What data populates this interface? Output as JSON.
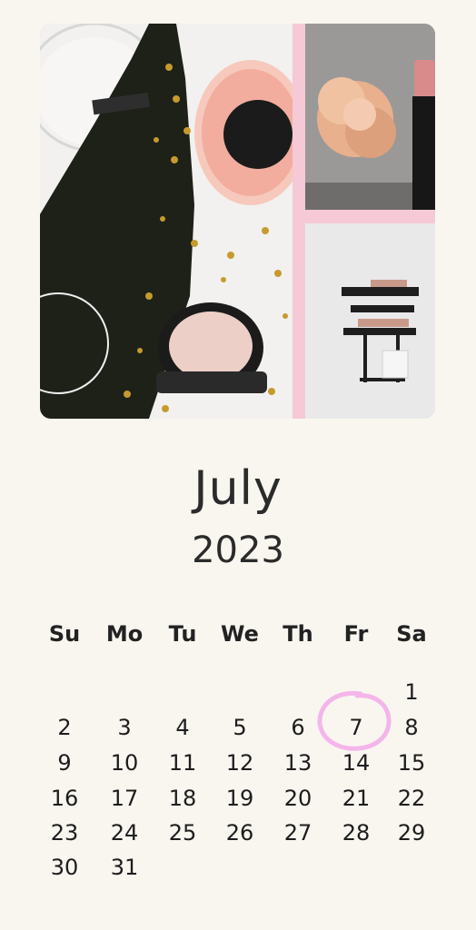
{
  "calendar": {
    "month": "July",
    "year": "2023",
    "weekdays": [
      "Su",
      "Mo",
      "Tu",
      "We",
      "Th",
      "Fr",
      "Sa"
    ],
    "weeks": [
      [
        "",
        "",
        "",
        "",
        "",
        "",
        "1"
      ],
      [
        "2",
        "3",
        "4",
        "5",
        "6",
        "7",
        "8"
      ],
      [
        "9",
        "10",
        "11",
        "12",
        "13",
        "14",
        "15"
      ],
      [
        "16",
        "17",
        "18",
        "19",
        "20",
        "21",
        "22"
      ],
      [
        "23",
        "24",
        "25",
        "26",
        "27",
        "28",
        "29"
      ],
      [
        "30",
        "31",
        "",
        "",
        "",
        "",
        ""
      ]
    ],
    "highlighted_day": "7",
    "highlight_color": "#f4b6ea"
  },
  "collage": {
    "colors": {
      "border": "#f5c9d6",
      "bottle": "#1d2118",
      "rose": "#f3b7a8",
      "peony": "#e9b08d"
    }
  }
}
